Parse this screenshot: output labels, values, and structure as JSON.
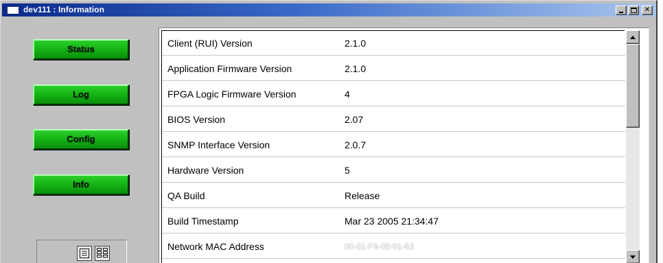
{
  "window": {
    "title": "dev111 : Information"
  },
  "nav": {
    "buttons": [
      {
        "label": "Status"
      },
      {
        "label": "Log"
      },
      {
        "label": "Config"
      },
      {
        "label": "Info"
      }
    ]
  },
  "view_toggle": {
    "list_icon": "list-view-icon",
    "grid_icon": "grid-view-icon"
  },
  "info_table": {
    "rows": [
      {
        "label": "Client (RUI) Version",
        "value": "2.1.0"
      },
      {
        "label": "Application Firmware Version",
        "value": "2.1.0"
      },
      {
        "label": "FPGA Logic Firmware Version",
        "value": "4"
      },
      {
        "label": "BIOS Version",
        "value": "2.07"
      },
      {
        "label": "SNMP Interface Version",
        "value": "2.0.7"
      },
      {
        "label": "Hardware Version",
        "value": "5"
      },
      {
        "label": "QA Build",
        "value": "Release"
      },
      {
        "label": "Build Timestamp",
        "value": "Mar 23 2005 21:34:47"
      },
      {
        "label": "Network MAC Address",
        "value": "00-01-F9-00-01-63"
      }
    ]
  },
  "colors": {
    "nav_button": "#16b516",
    "titlebar_start": "#0a2a8a",
    "titlebar_end": "#a9c6ee"
  }
}
